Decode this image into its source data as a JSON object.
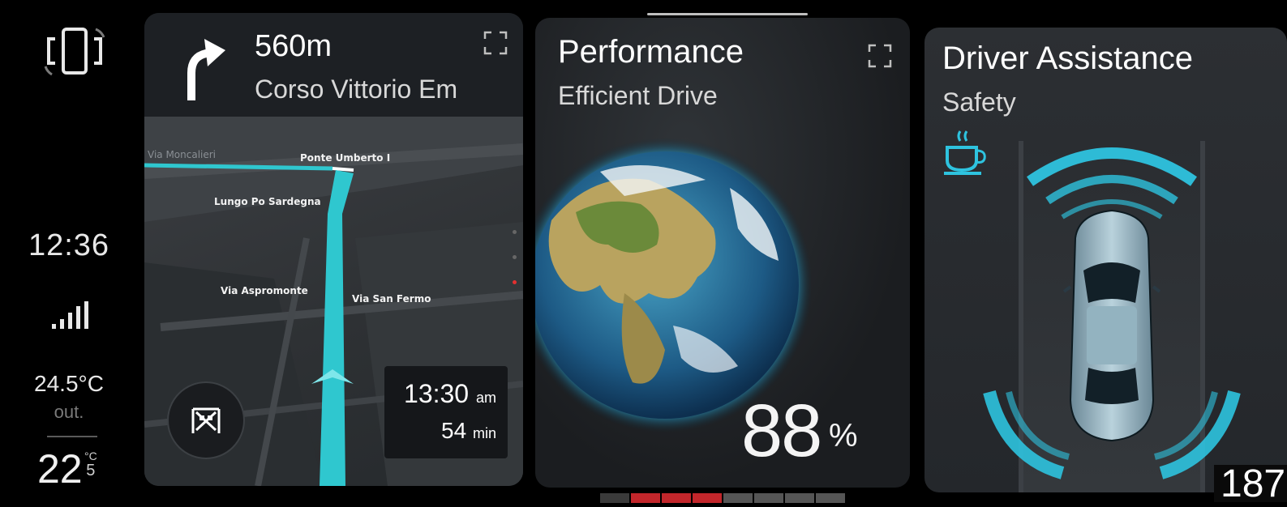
{
  "status": {
    "clock": "12:36",
    "outside_temp": "24.5°C",
    "outside_label": "out.",
    "inside_temp": "22",
    "inside_unit": "°C",
    "inside_decimal": "5",
    "icons": [
      "phone-mirroring-icon",
      "signal-strength-icon"
    ]
  },
  "navigation": {
    "distance": "560m",
    "street": "Corso Vittorio Em",
    "turn_icon": "turn-right-arrow-icon",
    "map_labels": {
      "lungo": "Lungo Po Sardegna",
      "ponte": "Ponte Umberto I",
      "aspromonte": "Via Aspromonte",
      "sanfermo": "Via San Fermo",
      "faded": "Via Moncalieri"
    },
    "eta_time": "13:30",
    "eta_suffix": "am",
    "eta_duration": "54",
    "eta_duration_unit": "min",
    "route_color": "#2fc7cf"
  },
  "performance": {
    "title": "Performance",
    "subtitle": "Efficient Drive",
    "value": "88",
    "unit": "%"
  },
  "driver_assistance": {
    "title": "Driver Assistance",
    "subtitle": "Safety",
    "icon": "coffee-cup-icon",
    "accent": "#2ec3df"
  },
  "speed": {
    "value": "187"
  }
}
